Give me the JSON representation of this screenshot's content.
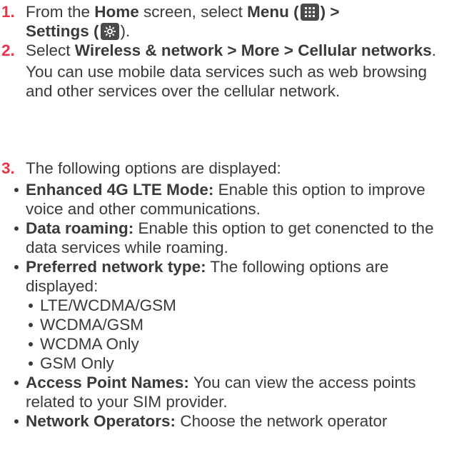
{
  "steps": [
    {
      "number": "1.",
      "t1": "From the ",
      "home": "Home",
      "t2": " screen, select ",
      "menu": "Menu (",
      "menu_close": ") >",
      "settings": "Settings (",
      "settings_close": ")."
    },
    {
      "number": "2.",
      "path": "Wireless & network > More > Cellular networks",
      "period": ".",
      "note": "You can use mobile data services such as web browsing and other services over the cellular network."
    },
    {
      "number": "3.",
      "intro": "The following options are displayed:",
      "options": [
        {
          "term": "Enhanced 4G LTE Mode:",
          "desc": " Enable this option to improve voice and other communications."
        },
        {
          "term": "Data roaming:",
          "desc": " Enable this option to get conencted to the data services while roaming."
        },
        {
          "term": "Preferred network type:",
          "desc": " The following options are displayed:",
          "sub": [
            "LTE/WCDMA/GSM",
            "WCDMA/GSM",
            "WCDMA Only",
            "GSM Only"
          ]
        },
        {
          "term": "Access Point Names:",
          "desc": " You can view the access points related to your SIM provider."
        },
        {
          "term": "Network Operators:",
          "desc": " Choose the network operator"
        }
      ]
    }
  ],
  "icons": {
    "menu": "apps-grid-icon",
    "settings": "gear-icon",
    "icon_bg": "#4a4a4a",
    "accent": "#e8334a"
  }
}
